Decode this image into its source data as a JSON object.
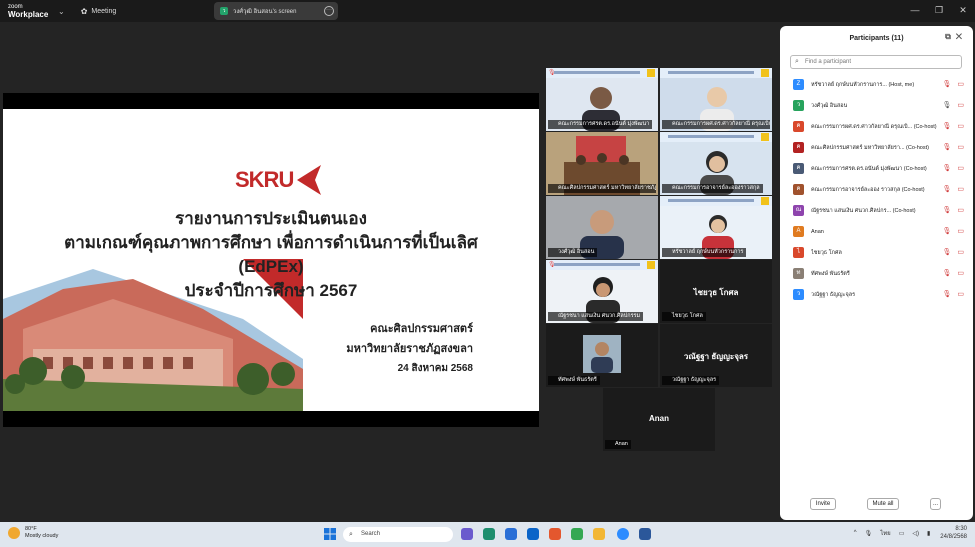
{
  "titlebar": {
    "logo_line1": "zoom",
    "logo_line2": "Workplace",
    "meeting_label": "Meeting",
    "share_tab_label": "วงศ์วุฒิ อินสอน's screen"
  },
  "slide": {
    "logo_text": "SKRU",
    "title_lines": [
      "รายงานการประเมินตนเอง",
      "ตามเกณฑ์คุณภาพการศึกษา เพื่อการดำเนินการที่เป็นเลิศ",
      "(EdPEx)",
      "ประจำปีการศึกษา 2567"
    ],
    "faculty": "คณะศิลปกรรมศาสตร์",
    "university": "มหาวิทยาลัยราชภัฏสงขลา",
    "date": "24 สิงหาคม 2568"
  },
  "gallery": [
    {
      "name": "คณะกรรมการศรต.ดร.อนันต์ มุ่งพัฒนา"
    },
    {
      "name": "คณะกรรมการผศ.ดร.ศาวกัลยาณี ดรุณเบิกรัฐ"
    },
    {
      "name": "คณะศิลปกรรมศาสตร์ มหาวิทยาลัยราชภัฏ..."
    },
    {
      "name": "คณะกรรมการอาจารย์ละอองราวสกุล"
    },
    {
      "name": "วงศ์วุฒิ อินสอน"
    },
    {
      "name": "หรัชวาลย์ ฤกษ์บนหัวกรานการ"
    },
    {
      "name": "ณัฐรชนา แสนเงิน ศนวก.ศิลปกรรม"
    },
    {
      "name": "ไชยวุธ โกศล",
      "big": "ไชยวุธ โกศล"
    },
    {
      "name": "ทัศพงษ์ พันธรัตรี"
    },
    {
      "name": "วณัฐฐา ธัญญะจุลร",
      "big": "วณัฐฐา ธัญญะจุลร"
    },
    {
      "name": "Anan",
      "big": "Anan"
    }
  ],
  "participants": {
    "title": "Participants (11)",
    "search_placeholder": "Find a participant",
    "list": [
      {
        "initial": "Z",
        "color": "#2d8cff",
        "name": "หรัชวาลย์ ฤกษ์บนหัวกรานการ... (Host, me)"
      },
      {
        "initial": "ว",
        "color": "#27a35d",
        "name": "วงศ์วุฒิ อินสอน"
      },
      {
        "initial": "ค",
        "color": "#d9482b",
        "name": "คณะกรรมการผศ.ดร.ศาวกัลยาณี ดรุณเบิ... (Co-host)"
      },
      {
        "initial": "ค",
        "color": "#b22222",
        "name": "คณะศิลปกรรมศาสตร์ มหาวิทยาลัยรา... (Co-host)"
      },
      {
        "initial": "ค",
        "color": "#4a5a75",
        "name": "คณะกรรมการศรต.ดร.อนันต์ มุ่งพัฒนา (Co-host)"
      },
      {
        "initial": "ค",
        "color": "#a0522d",
        "name": "คณะกรรมการอาจารย์ละออง ราวสกุล (Co-host)"
      },
      {
        "initial": "ณ",
        "color": "#8e44ad",
        "name": "ณัฐรชนา แสนเงิน ศนวก.ศิลปกร... (Co-host)"
      },
      {
        "initial": "A",
        "color": "#e07b20",
        "name": "Anan"
      },
      {
        "initial": "ไ",
        "color": "#d9482b",
        "name": "ไชยวุธ โกศล"
      },
      {
        "initial": "ท",
        "color": "#8a7f75",
        "name": "ทัศพงษ์ พันธรัตรี"
      },
      {
        "initial": "ว",
        "color": "#2d8cff",
        "name": "วณัฐฐา ธัญญะจุลร"
      }
    ],
    "invite_label": "Invite",
    "mute_all_label": "Mute all",
    "more_label": "..."
  },
  "taskbar": {
    "temperature": "80°F",
    "weather": "Mostly cloudy",
    "search_placeholder": "Search",
    "lang": "ไทย",
    "time": "8:30",
    "date": "24/8/2568"
  }
}
